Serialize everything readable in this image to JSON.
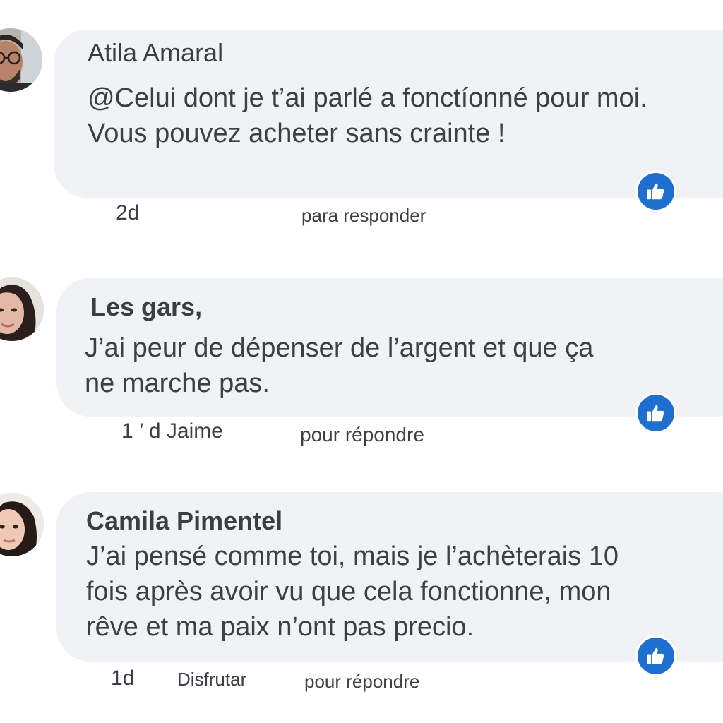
{
  "comments": [
    {
      "author": "Atila Amaral",
      "text_lines": [
        "@Celui dont je t’ai parlé a fonctíonné pour moi.",
        "Vous pouvez acheter sans crainte !"
      ],
      "time": "2d",
      "actions": [
        "para responder"
      ],
      "avatar_icon": "man-with-glasses-avatar",
      "like_icon": "thumbs-up-icon"
    },
    {
      "author": "Les gars,",
      "text_lines": [
        "J’ai peur de dépenser de l’argent et que ça",
        "ne marche pas."
      ],
      "time": "1 ’ d Jaime",
      "actions": [
        "pour répondre"
      ],
      "avatar_icon": "woman-dark-hair-avatar",
      "like_icon": "thumbs-up-icon"
    },
    {
      "author": "Camila Pimentel",
      "text_lines": [
        "J’ai pensé comme toi, mais je l’achèterais 10",
        "fois après avoir vu que cela fonctionne, mon",
        "rêve et ma paix n’ont pas precio."
      ],
      "time": "1d",
      "actions": [
        "Disfrutar",
        "pour répondre"
      ],
      "avatar_icon": "woman-dark-hair-avatar",
      "like_icon": "thumbs-up-icon"
    }
  ],
  "colors": {
    "bubble": "#f0f2f5",
    "like_badge": "#1e6fd0",
    "text": "#3c3f45"
  }
}
